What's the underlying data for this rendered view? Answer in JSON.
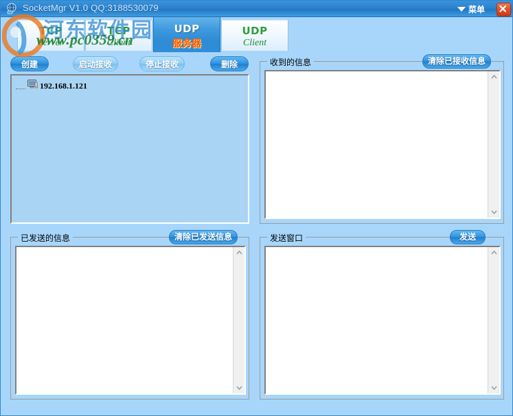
{
  "window": {
    "title": "SocketMgr V1.0  QQ:3188530079",
    "app_icon": "globe-icon",
    "menu_label": "菜单",
    "menu_icon": "chevron-down-icon",
    "close_icon": "close-icon",
    "titlebar_color": "#2d83cd",
    "background_color": "#a8d6fa"
  },
  "watermark": {
    "site_cn": "河东软件园",
    "site_url": "www.pc0359.cn",
    "logo": "qq-penguin-logo"
  },
  "tabs": [
    {
      "line1": "TCP",
      "line2": "Server",
      "active": false
    },
    {
      "line1": "TCP",
      "line2": "Client",
      "active": false
    },
    {
      "line1": "UDP",
      "line2": "服务器",
      "active": true
    },
    {
      "line1": "UDP",
      "line2": "Client",
      "active": false
    }
  ],
  "toolbar": {
    "create_label": "创建",
    "start_recv_label": "启动接收",
    "stop_recv_label": "停止接收",
    "delete_label": "删除"
  },
  "tree": {
    "icon": "computer-icon",
    "items": [
      {
        "label": "192.168.1.121"
      }
    ]
  },
  "panels": {
    "received": {
      "legend": "收到的信息",
      "button": "清除已接收信息",
      "value": "",
      "scrollbar": {
        "up_icon": "chevron-up-icon",
        "down_icon": "chevron-down-icon"
      }
    },
    "sent": {
      "legend": "已发送的信息",
      "button": "清除已发送信息",
      "value": "",
      "scrollbar": {
        "up_icon": "chevron-up-icon",
        "down_icon": "chevron-down-icon"
      }
    },
    "send": {
      "legend": "发送窗口",
      "button": "发送",
      "value": "",
      "scrollbar": {
        "up_icon": "chevron-up-icon",
        "down_icon": "chevron-down-icon"
      }
    }
  }
}
